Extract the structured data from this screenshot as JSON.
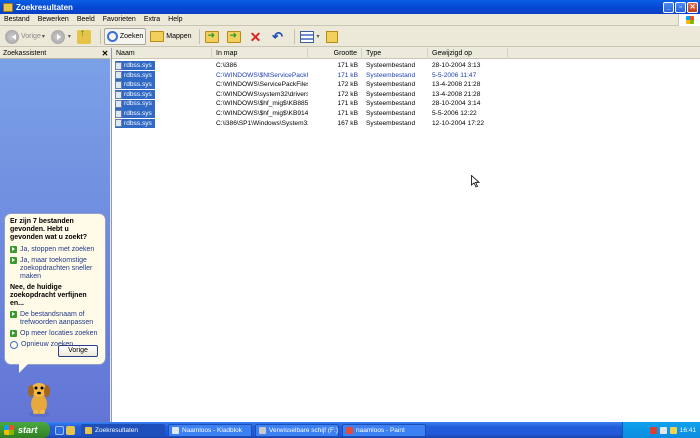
{
  "window": {
    "title": "Zoekresultaten"
  },
  "menu": [
    "Bestand",
    "Bewerken",
    "Beeld",
    "Favorieten",
    "Extra",
    "Help"
  ],
  "toolbar": {
    "back_label": "Vorige",
    "search_label": "Zoeken",
    "folders_label": "Mappen"
  },
  "search_pane": {
    "title": "Zoekassistent",
    "question": "Er zijn 7 bestanden gevonden. Hebt u gevonden wat u zoekt?",
    "options": [
      "Ja, stoppen met zoeken",
      "Ja, maar toekomstige zoekopdrachten sneller maken"
    ],
    "refine_heading": "Nee, de huidige zoekopdracht verfijnen en...",
    "refine_options": [
      "De bestandsnaam of trefwoorden aanpassen",
      "Op meer locaties zoeken",
      "Opnieuw zoeken"
    ],
    "next_button": "Vorige"
  },
  "columns": [
    "Naam",
    "In map",
    "Grootte",
    "Type",
    "Gewijzigd op"
  ],
  "files": [
    {
      "name": "rdbss.sys",
      "folder": "C:\\i386",
      "size": "171 kB",
      "type": "Systeembestand",
      "modified": "28-10-2004 3:13",
      "blue": false
    },
    {
      "name": "rdbss.sys",
      "folder": "C:\\WINDOWS\\$NtServicePackU...",
      "size": "171 kB",
      "type": "Systeembestand",
      "modified": "5-5-2006 11:47",
      "blue": true
    },
    {
      "name": "rdbss.sys",
      "folder": "C:\\WINDOWS\\ServicePackFiles\\...",
      "size": "172 kB",
      "type": "Systeembestand",
      "modified": "13-4-2008 21:28",
      "blue": false
    },
    {
      "name": "rdbss.sys",
      "folder": "C:\\WINDOWS\\system32\\drivers",
      "size": "172 kB",
      "type": "Systeembestand",
      "modified": "13-4-2008 21:28",
      "blue": false
    },
    {
      "name": "rdbss.sys",
      "folder": "C:\\WINDOWS\\$hf_mig$\\KB8858...",
      "size": "171 kB",
      "type": "Systeembestand",
      "modified": "28-10-2004 3:14",
      "blue": false
    },
    {
      "name": "rdbss.sys",
      "folder": "C:\\WINDOWS\\$hf_mig$\\KB9143...",
      "size": "171 kB",
      "type": "Systeembestand",
      "modified": "5-5-2006 12:22",
      "blue": false
    },
    {
      "name": "rdbss.sys",
      "folder": "C:\\i386\\SP1\\Windows\\System32...",
      "size": "167 kB",
      "type": "Systeembestand",
      "modified": "12-10-2004 17:22",
      "blue": false
    }
  ],
  "taskbar": {
    "start_label": "start",
    "tasks": [
      "Zoekresultaten",
      "Naamloos - Kladblok",
      "Verwisselbare schijf (F:)",
      "naamloos - Paint"
    ],
    "clock": "16:41"
  }
}
